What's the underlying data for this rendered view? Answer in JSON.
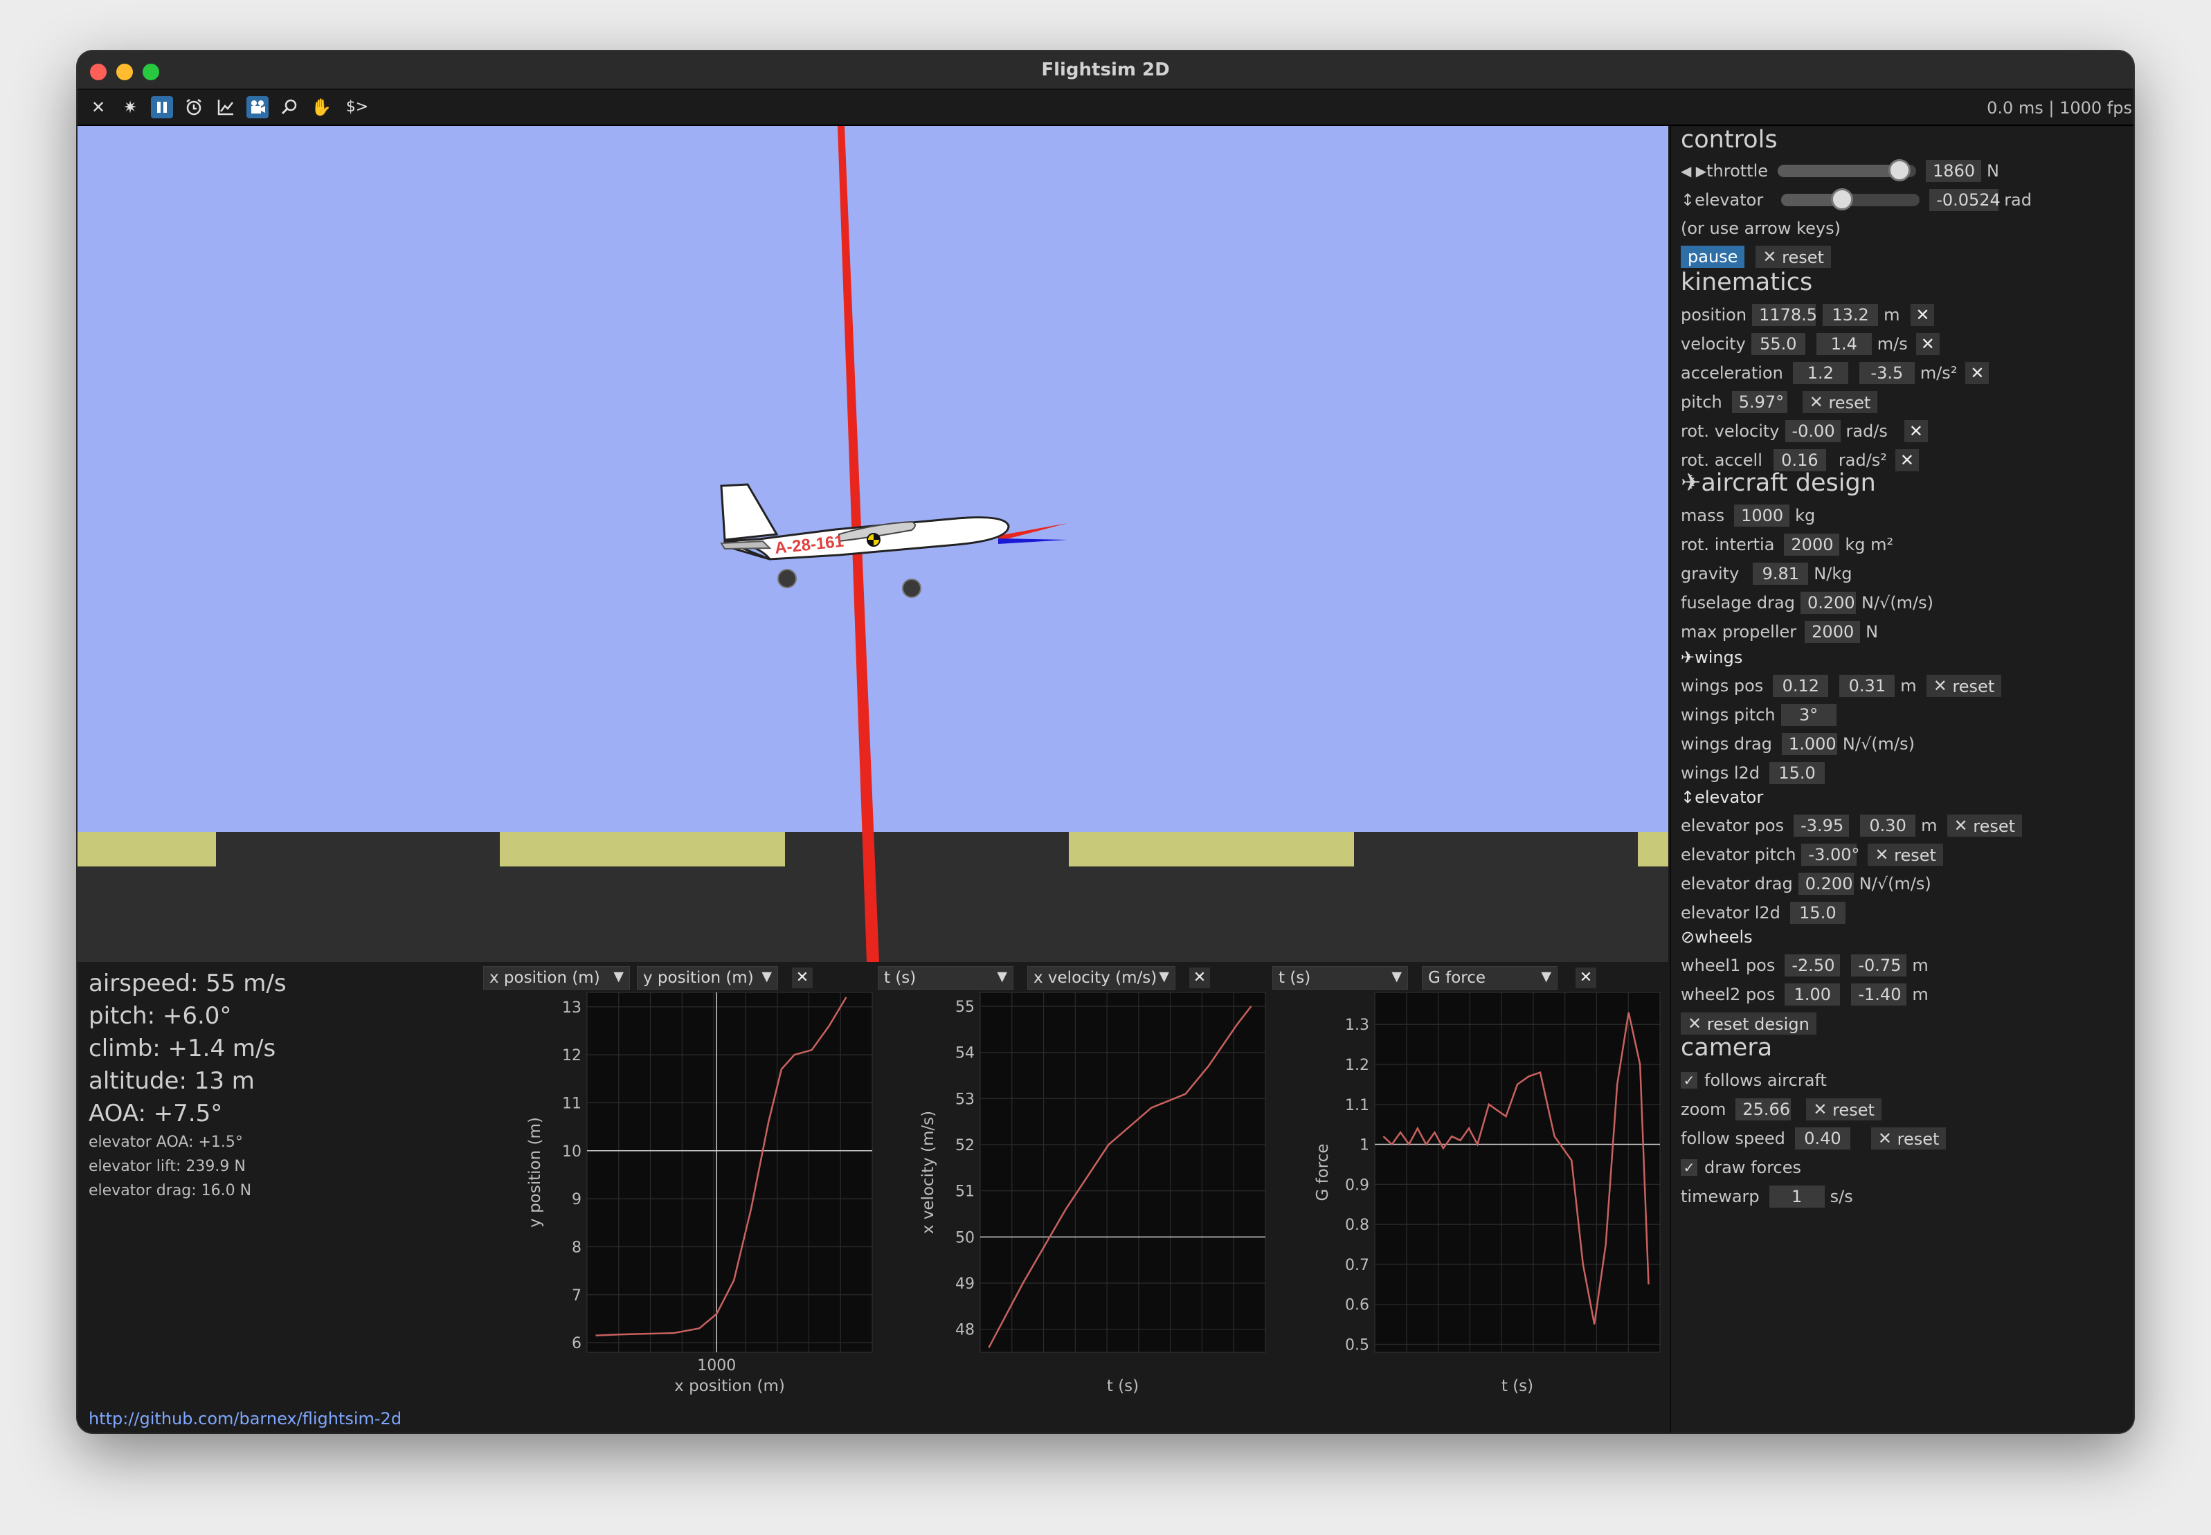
{
  "window": {
    "title": "Flightsim 2D"
  },
  "toolbar": {
    "fps_text": "0.0 ms | 1000 fps",
    "icons": [
      "close-icon",
      "gear-icon",
      "pause-icon",
      "alarm-clock-icon",
      "chart-icon",
      "camera-icon",
      "search-icon",
      "hand-icon",
      "console-icon"
    ]
  },
  "aircraft": {
    "registration": "A-28-161"
  },
  "stats": {
    "airspeed": "airspeed: 55 m/s",
    "pitch": "pitch: +6.0°",
    "climb": "climb: +1.4 m/s",
    "altitude": "altitude: 13 m",
    "aoa": "AOA: +7.5°",
    "elevator_aoa": "elevator AOA: +1.5°",
    "elevator_lift": "elevator lift: 239.9 N",
    "elevator_drag": "elevator drag: 16.0 N"
  },
  "plot_selectors": {
    "p1_x": "x position (m)",
    "p1_y": "y position (m)",
    "p2_x": "t (s)",
    "p2_y": "x velocity (m/s)",
    "p3_x": "t (s)",
    "p3_y": "G force"
  },
  "chart_data": [
    {
      "type": "line",
      "xlabel": "x position (m)",
      "ylabel": "y position (m)",
      "xlim": [
        850,
        1180
      ],
      "ylim": [
        5.8,
        13.3
      ],
      "x_ticks": [
        1000
      ],
      "y_ticks": [
        6,
        7,
        8,
        9,
        10,
        11,
        12,
        13
      ],
      "x": [
        860,
        900,
        950,
        980,
        1000,
        1020,
        1040,
        1060,
        1075,
        1090,
        1110,
        1130,
        1150
      ],
      "y": [
        6.15,
        6.18,
        6.2,
        6.3,
        6.6,
        7.3,
        8.8,
        10.6,
        11.7,
        12.0,
        12.1,
        12.6,
        13.2
      ]
    },
    {
      "type": "line",
      "xlabel": "t (s)",
      "ylabel": "x velocity (m/s)",
      "xlim": [
        0,
        10
      ],
      "ylim": [
        47.5,
        55.3
      ],
      "y_ticks": [
        48,
        49,
        50,
        51,
        52,
        53,
        54,
        55
      ],
      "x": [
        0.3,
        1.5,
        3,
        4.5,
        6,
        7.2,
        8,
        9,
        9.5
      ],
      "y": [
        47.6,
        49.0,
        50.6,
        52.0,
        52.8,
        53.1,
        53.7,
        54.6,
        55.0
      ]
    },
    {
      "type": "line",
      "xlabel": "t (s)",
      "ylabel": "G force",
      "xlim": [
        0,
        10
      ],
      "ylim": [
        0.48,
        1.38
      ],
      "y_ticks": [
        0.5,
        0.6,
        0.7,
        0.8,
        0.9,
        1,
        1.1,
        1.2,
        1.3
      ],
      "x": [
        0.3,
        0.6,
        0.9,
        1.2,
        1.5,
        1.8,
        2.1,
        2.4,
        2.7,
        3.0,
        3.3,
        3.6,
        4.0,
        4.6,
        5.0,
        5.4,
        5.8,
        6.3,
        6.9,
        7.3,
        7.7,
        8.1,
        8.5,
        8.9,
        9.3,
        9.6
      ],
      "y": [
        1.02,
        1.0,
        1.03,
        1.0,
        1.04,
        1.0,
        1.03,
        0.99,
        1.02,
        1.01,
        1.04,
        1.0,
        1.1,
        1.07,
        1.15,
        1.17,
        1.18,
        1.02,
        0.96,
        0.7,
        0.55,
        0.75,
        1.15,
        1.33,
        1.2,
        0.65
      ]
    }
  ],
  "side": {
    "controls": {
      "header": "controls",
      "throttle_label": "throttle",
      "throttle_value": "1860",
      "throttle_unit": "N",
      "throttle_level": 0.88,
      "elevator_label": "elevator",
      "elevator_value": "-0.0524",
      "elevator_unit": "rad",
      "elevator_level": 0.42,
      "hint": "(or use arrow keys)",
      "pause": "pause",
      "reset": "reset"
    },
    "kinematics": {
      "header": "kinematics",
      "position_label": "position",
      "position_x": "1178.5",
      "position_y": "13.2",
      "position_unit": "m",
      "velocity_label": "velocity",
      "velocity_x": "55.0",
      "velocity_y": "1.4",
      "velocity_unit": "m/s",
      "acceleration_label": "acceleration",
      "acceleration_x": "1.2",
      "acceleration_y": "-3.5",
      "acceleration_unit": "m/s²",
      "pitch_label": "pitch",
      "pitch_value": "5.97°",
      "pitch_reset": "reset",
      "rot_velocity_label": "rot. velocity",
      "rot_velocity_value": "-0.00",
      "rot_velocity_unit": "rad/s",
      "rot_accel_label": "rot. accell",
      "rot_accel_value": "0.16",
      "rot_accel_unit": "rad/s²"
    },
    "design": {
      "header": "aircraft design",
      "mass_label": "mass",
      "mass_value": "1000",
      "mass_unit": "kg",
      "inertia_label": "rot. intertia",
      "inertia_value": "2000",
      "inertia_unit": "kg m²",
      "gravity_label": "gravity",
      "gravity_value": "9.81",
      "gravity_unit": "N/kg",
      "fuselage_label": "fuselage drag",
      "fuselage_value": "0.200",
      "fuselage_unit": "N/√(m/s)",
      "propeller_label": "max propeller",
      "propeller_value": "2000",
      "propeller_unit": "N",
      "wings_header": "wings",
      "wings_pos_label": "wings pos",
      "wings_pos_x": "0.12",
      "wings_pos_y": "0.31",
      "wings_pos_unit": "m",
      "wings_reset": "reset",
      "wings_pitch_label": "wings pitch",
      "wings_pitch_value": "3°",
      "wings_drag_label": "wings drag",
      "wings_drag_value": "1.000",
      "wings_drag_unit": "N/√(m/s)",
      "wings_l2d_label": "wings l2d",
      "wings_l2d_value": "15.0",
      "elevator_header": "elevator",
      "elev_pos_label": "elevator pos",
      "elev_pos_x": "-3.95",
      "elev_pos_y": "0.30",
      "elev_pos_unit": "m",
      "elev_reset": "reset",
      "elev_pitch_label": "elevator pitch",
      "elev_pitch_value": "-3.00°",
      "elev_pitch_reset": "reset",
      "elev_drag_label": "elevator drag",
      "elev_drag_value": "0.200",
      "elev_drag_unit": "N/√(m/s)",
      "elev_l2d_label": "elevator l2d",
      "elev_l2d_value": "15.0",
      "wheels_header": "wheels",
      "wheel1_label": "wheel1 pos",
      "wheel1_x": "-2.50",
      "wheel1_y": "-0.75",
      "wheel1_unit": "m",
      "wheel2_label": "wheel2 pos",
      "wheel2_x": "1.00",
      "wheel2_y": "-1.40",
      "wheel2_unit": "m",
      "reset_design": "reset design"
    },
    "camera": {
      "header": "camera",
      "follows_label": "follows aircraft",
      "follows_checked": true,
      "zoom_label": "zoom",
      "zoom_value": "25.66",
      "zoom_reset": "reset",
      "follow_speed_label": "follow speed",
      "follow_speed_value": "0.40",
      "follow_speed_reset": "reset",
      "draw_forces_label": "draw forces",
      "draw_forces_checked": true,
      "timewarp_label": "timewarp",
      "timewarp_value": "1",
      "timewarp_unit": "s/s"
    }
  },
  "footer": {
    "link": "http://github.com/barnex/flightsim-2d"
  },
  "colors": {
    "sky": "#9eaff5",
    "ground": "#2f2f2f",
    "runway_stripe": "#c9c97a",
    "force_red": "#e8261e",
    "force_blue": "#1a1ad6",
    "plot_line": "#c9625f",
    "accent": "#2f6fa8"
  }
}
